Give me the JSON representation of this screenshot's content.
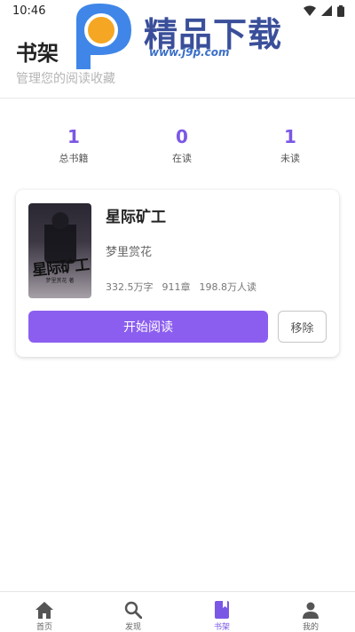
{
  "status_bar": {
    "time": "10:46"
  },
  "watermark": {
    "text": "精品下载",
    "url": "www.j9p.com"
  },
  "header": {
    "title": "书架",
    "subtitle": "管理您的阅读收藏"
  },
  "stats": [
    {
      "value": "1",
      "label": "总书籍"
    },
    {
      "value": "0",
      "label": "在读"
    },
    {
      "value": "1",
      "label": "未读"
    }
  ],
  "book": {
    "cover_title": "星际矿工",
    "cover_author": "梦里赏花 著",
    "title": "星际矿工",
    "author": "梦里赏花",
    "words": "332.5万字",
    "chapters": "911章",
    "readers": "198.8万人读",
    "read_label": "开始阅读",
    "remove_label": "移除"
  },
  "nav": [
    {
      "label": "首页",
      "icon": "home-icon",
      "active": false
    },
    {
      "label": "发现",
      "icon": "search-icon",
      "active": false
    },
    {
      "label": "书架",
      "icon": "book-icon",
      "active": true
    },
    {
      "label": "我的",
      "icon": "person-icon",
      "active": false
    }
  ],
  "colors": {
    "accent": "#7b57e6",
    "button": "#8c5ef0"
  }
}
